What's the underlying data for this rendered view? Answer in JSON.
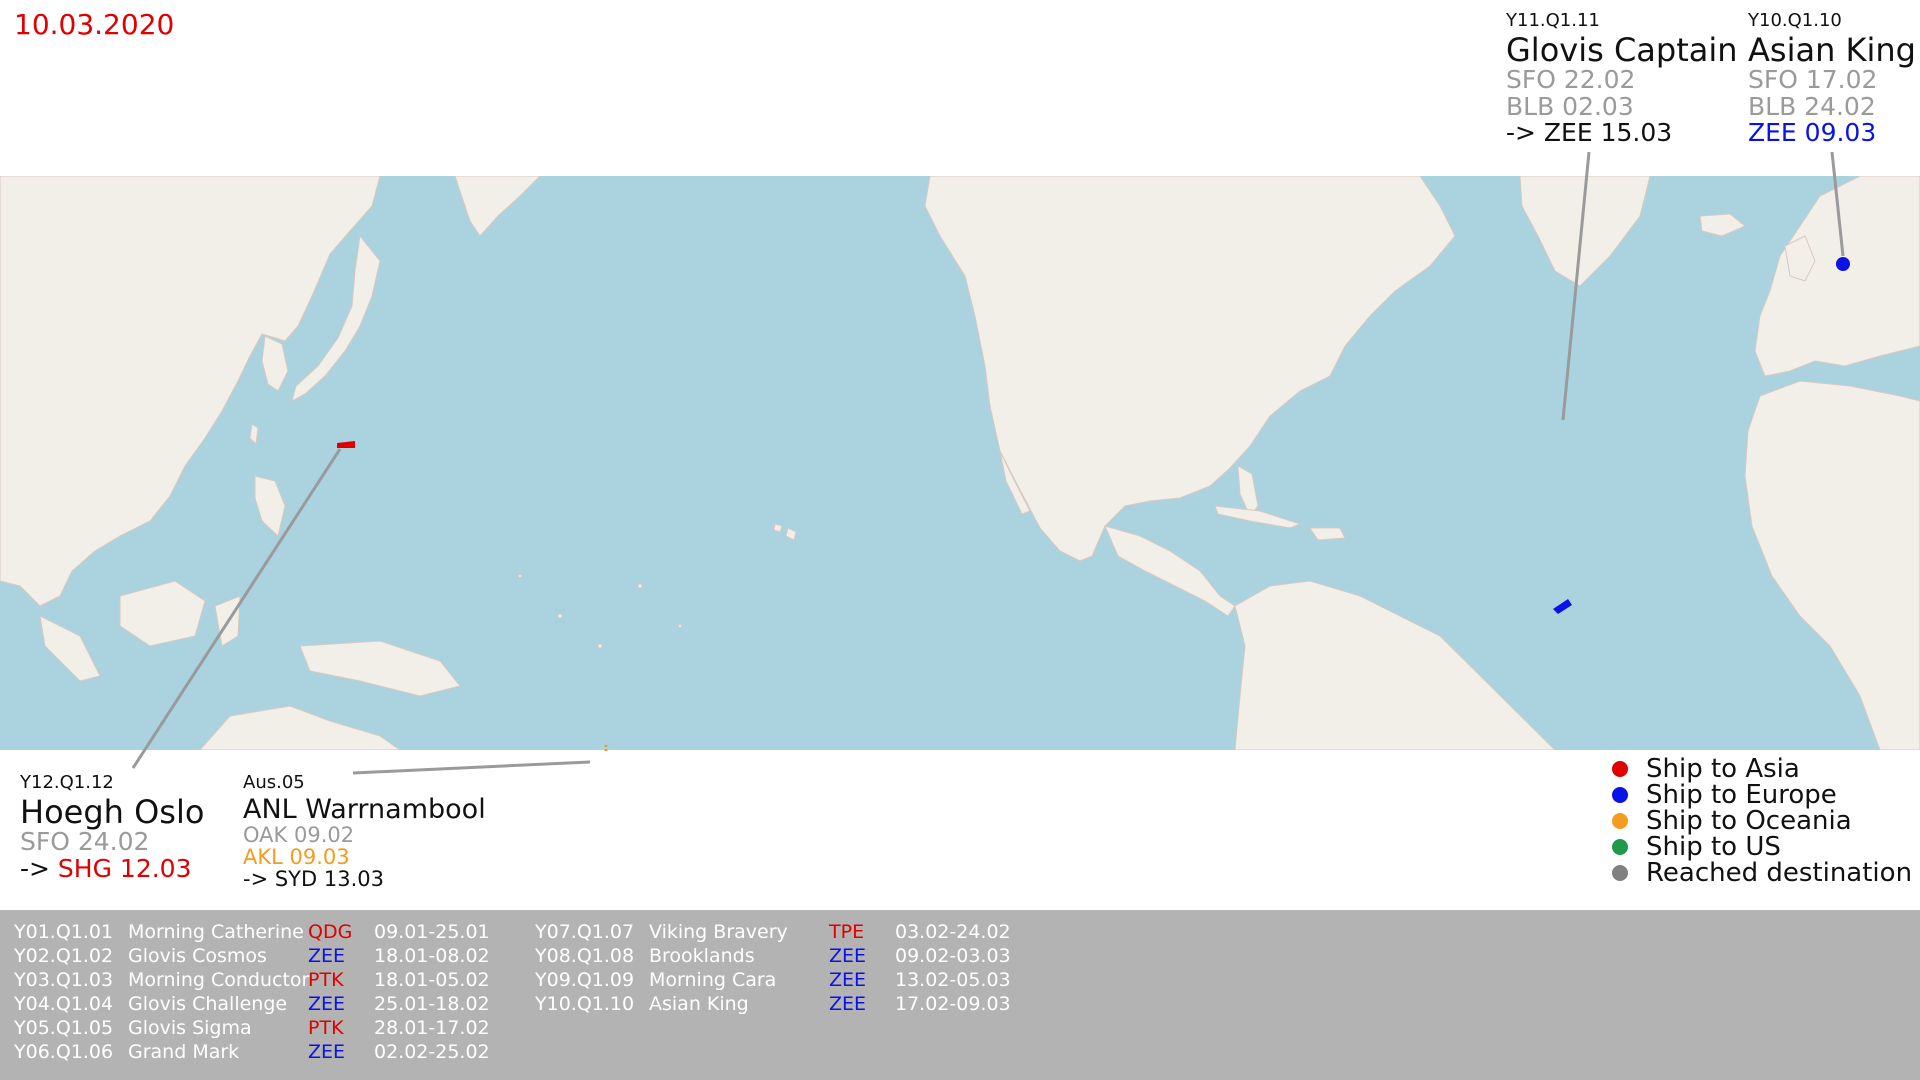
{
  "date": "10.03.2020",
  "colors": {
    "asia": "#e00000",
    "europe": "#0a12e6",
    "oceania": "#f39c1f",
    "us": "#1e9a4a",
    "reached": "#808080",
    "ocean": "#aad3df",
    "land": "#f2efe9",
    "panel": "#b3b3b3"
  },
  "callouts": {
    "glovis_captain": {
      "code": "Y11.Q1.11",
      "name": "Glovis Captain",
      "line1": "SFO 22.02",
      "line2": "BLB 02.03",
      "line3": "-> ZEE 15.03"
    },
    "asian_king": {
      "code": "Y10.Q1.10",
      "name": "Asian King",
      "line1": "SFO 17.02",
      "line2": "BLB 24.02",
      "line3": "ZEE 09.03"
    },
    "hoegh_oslo": {
      "code": "Y12.Q1.12",
      "name": "Hoegh Oslo",
      "line1": "SFO 24.02",
      "line2_prefix": "->",
      "line2_dest": "SHG 12.03"
    },
    "anl_warrnambool": {
      "code": "Aus.05",
      "name": "ANL Warrnambool",
      "line1": "OAK 09.02",
      "line2": "AKL 09.03",
      "line3": "-> SYD 13.03"
    }
  },
  "legend": [
    {
      "label": "Ship to Asia",
      "color": "#e00000"
    },
    {
      "label": "Ship to Europe",
      "color": "#0a12e6"
    },
    {
      "label": "Ship to Oceania",
      "color": "#f39c1f"
    },
    {
      "label": "Ship to US",
      "color": "#1e9a4a"
    },
    {
      "label": "Reached destination",
      "color": "#808080"
    }
  ],
  "table": {
    "column1": [
      {
        "code": "Y01.Q1.01",
        "ship": "Morning Catherine",
        "dest": "QDG",
        "dest_color": "#e00000",
        "dates": "09.01-25.01"
      },
      {
        "code": "Y02.Q1.02",
        "ship": "Glovis Cosmos",
        "dest": "ZEE",
        "dest_color": "#0a12e6",
        "dates": "18.01-08.02"
      },
      {
        "code": "Y03.Q1.03",
        "ship": "Morning Conductor",
        "dest": "PTK",
        "dest_color": "#e00000",
        "dates": "18.01-05.02"
      },
      {
        "code": "Y04.Q1.04",
        "ship": "Glovis Challenge",
        "dest": "ZEE",
        "dest_color": "#0a12e6",
        "dates": "25.01-18.02"
      },
      {
        "code": "Y05.Q1.05",
        "ship": "Glovis Sigma",
        "dest": "PTK",
        "dest_color": "#e00000",
        "dates": "28.01-17.02"
      },
      {
        "code": "Y06.Q1.06",
        "ship": "Grand Mark",
        "dest": "ZEE",
        "dest_color": "#0a12e6",
        "dates": "02.02-25.02"
      }
    ],
    "column2": [
      {
        "code": "Y07.Q1.07",
        "ship": "Viking Bravery",
        "dest": "TPE",
        "dest_color": "#e00000",
        "dates": "03.02-24.02"
      },
      {
        "code": "Y08.Q1.08",
        "ship": "Brooklands",
        "dest": "ZEE",
        "dest_color": "#0a12e6",
        "dates": "09.02-03.03"
      },
      {
        "code": "Y09.Q1.09",
        "ship": "Morning Cara",
        "dest": "ZEE",
        "dest_color": "#0a12e6",
        "dates": "13.02-05.03"
      },
      {
        "code": "Y10.Q1.10",
        "ship": "Asian King",
        "dest": "ZEE",
        "dest_color": "#0a12e6",
        "dates": "17.02-09.03"
      }
    ]
  }
}
